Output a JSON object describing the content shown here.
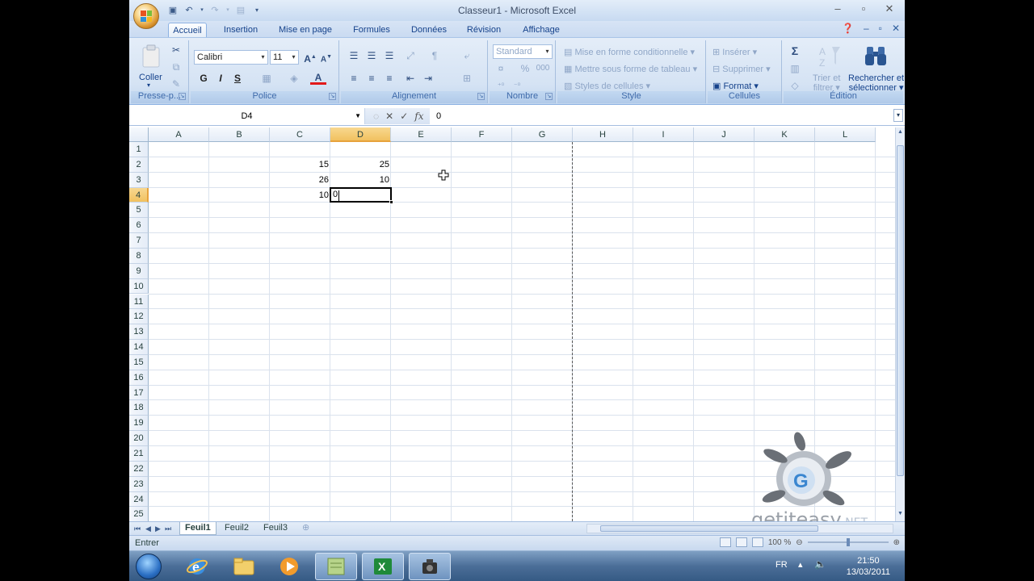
{
  "window": {
    "title": "Classeur1 - Microsoft Excel"
  },
  "ribbon_tabs": [
    {
      "label": "Accueil",
      "active": true
    },
    {
      "label": "Insertion"
    },
    {
      "label": "Mise en page"
    },
    {
      "label": "Formules"
    },
    {
      "label": "Données"
    },
    {
      "label": "Révision"
    },
    {
      "label": "Affichage"
    }
  ],
  "ribbon": {
    "clipboard": {
      "paste_label": "Coller",
      "group_label": "Presse-p..."
    },
    "font": {
      "font_name": "Calibri",
      "font_size": "11",
      "bold": "G",
      "italic": "I",
      "underline": "S",
      "grow": "A",
      "shrink": "A",
      "font_color": "A",
      "group_label": "Police"
    },
    "alignment": {
      "group_label": "Alignement"
    },
    "number": {
      "format": "Standard",
      "percent": "%",
      "thousands": "000",
      "group_label": "Nombre"
    },
    "style": {
      "conditional": "Mise en forme conditionnelle",
      "table": "Mettre sous forme de tableau",
      "cell_styles": "Styles de cellules",
      "group_label": "Style"
    },
    "cells": {
      "insert": "Insérer",
      "delete": "Supprimer",
      "format": "Format",
      "group_label": "Cellules"
    },
    "editing": {
      "sigma": "Σ",
      "sort": "Trier et",
      "sort2": "filtrer",
      "find": "Rechercher et",
      "find2": "sélectionner",
      "group_label": "Édition"
    }
  },
  "formula_bar": {
    "name_box": "D4",
    "fx": "fx",
    "value": "0"
  },
  "columns": [
    "A",
    "B",
    "C",
    "D",
    "E",
    "F",
    "G",
    "H",
    "I",
    "J",
    "K",
    "L"
  ],
  "selected_column": "D",
  "rows": [
    "1",
    "2",
    "3",
    "4",
    "5",
    "6",
    "7",
    "8",
    "9",
    "10",
    "11",
    "12",
    "13",
    "14",
    "15",
    "16",
    "17",
    "18",
    "19",
    "20",
    "21",
    "22",
    "23",
    "24",
    "25"
  ],
  "selected_row": "4",
  "cells": [
    {
      "ref": "C2",
      "value": "15"
    },
    {
      "ref": "D2",
      "value": "25"
    },
    {
      "ref": "C3",
      "value": "26"
    },
    {
      "ref": "D3",
      "value": "10"
    },
    {
      "ref": "C4",
      "value": "10"
    }
  ],
  "active_cell": {
    "ref": "D4",
    "editing_text": "0"
  },
  "sheets": [
    {
      "label": "Feuil1",
      "active": true
    },
    {
      "label": "Feuil2"
    },
    {
      "label": "Feuil3"
    }
  ],
  "status": {
    "mode": "Entrer",
    "zoom": "100 %"
  },
  "watermark": {
    "text": "getiteasy",
    "suffix": ".NET"
  },
  "taskbar": {
    "language": "FR",
    "time": "21:50",
    "date": "13/03/2011"
  }
}
